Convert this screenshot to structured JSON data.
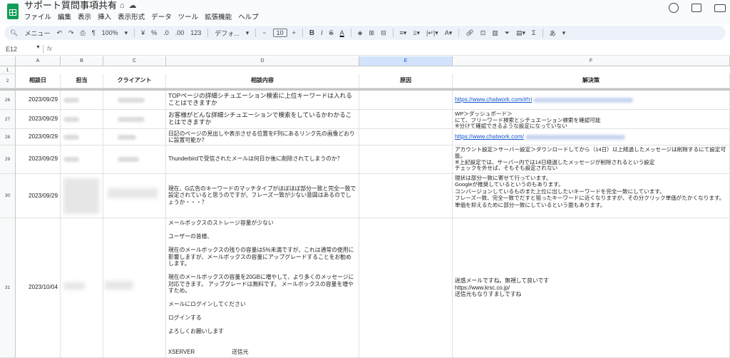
{
  "doc": {
    "title": "サポート質問事項共有"
  },
  "menu": [
    "ファイル",
    "編集",
    "表示",
    "挿入",
    "表示形式",
    "データ",
    "ツール",
    "拡張機能",
    "ヘルプ"
  ],
  "toolbar": {
    "menu_search": "メニュー",
    "zoom": "100%",
    "currency": "¥",
    "percent": "%",
    "dec_minus": ".0",
    "dec_plus": ".00",
    "number_format": "123",
    "font": "デフォ...",
    "font_size": "10",
    "bold": "B",
    "italic": "I",
    "input_tools": "あ"
  },
  "formula_bar": {
    "name_box": "E12",
    "fx": "fx"
  },
  "columns": [
    "A",
    "B",
    "C",
    "D",
    "E",
    "F"
  ],
  "header_row": {
    "row1": "1",
    "row2": "2",
    "date": "相談日",
    "owner": "担当",
    "client": "クライアント",
    "content": "相談内容",
    "cause": "原因",
    "solution": "解決策"
  },
  "rows": [
    {
      "num": "26",
      "date": "2023/09/29",
      "content": "TOPページの詳細シチュエーション検索に上位キーワードは入れることはできますか",
      "solution": "https://www.chatwork.com/#!ri"
    },
    {
      "num": "27",
      "date": "2023/09/29",
      "content": "お客様がどんな詳細シチュエーションで検索をしているかわかることはできますか",
      "solution": "WP＞ダッシュボード＞\nにて、フリーワード検索とシチュエーション検索を確認可能\n※分けて確認できるような設定になっていない"
    },
    {
      "num": "28",
      "date": "2023/09/29",
      "content": "日記のページの見出しや表示させる位置をF列にあるリンク先の画像どおりに設置可能か？",
      "solution": "https://www.chatwork.com/"
    },
    {
      "num": "29",
      "date": "2023/09/29",
      "content": "Thunderbirdで受信されたメールは何日か後に削除されてしまうのか？",
      "solution": "アカウント設定＞サーバー設定＞ダウンロードしてから（14日）以上経過したメッセージは削除するにて設定可能。\n※上記設定では、サーバー内では14日経過したメッセージが削除されるという設定\nチェックを外せば、そもそも設定されない"
    },
    {
      "num": "30",
      "date": "2023/09/29",
      "content": "現在、G広告のキーワードのマッチタイプがほぼほぼ部分一致と完全一致で設定されていると思うのですが、フレーズ一致が少ない意図はあるのでしょうか・・・？",
      "solution": "現状は部分一致に寄せて行っています。\nGoogleが推奨しているというのもあります。\nコンバージョンしているものまた上位に出したいキーワードを完全一致にしています。\nフレーズ一致、完全一致でだすと狙ったキーワードに近くなりますが、その分クリック単価がたかくなります。\n単価を抑えるために部分一致にしているという面もあります。"
    },
    {
      "num": "31",
      "date": "2023/10/04",
      "content": "メールボックスのストレージ容量が少ない\n\nユーザーの皆様、\n\n現在のメールボックスの残りの容量は5%未満ですが、これは通常の使用に影響しますが、メールボックスの容量にアップグレードすることをお勧めします。\n\n現在のメールボックスの容量を20GBに増やして、より多くのメッセージに対応できます。 アップグレードは無料です。 メールボックスの容量を増やすため。\n\nメールにログインしてください\n\nログインする\n\nよろしくお願いします\n\n\nXSERVER                        送信元",
      "solution": "迷惑メールですね。無視して良いです\nhttps://www.krsc.co.jp/\n送信元もなりすましですね"
    }
  ],
  "colors": {
    "accent": "#0b57d0",
    "link": "#1155cc",
    "sheets_green": "#0f9d58",
    "toolbar_bg": "#edf2fa"
  }
}
